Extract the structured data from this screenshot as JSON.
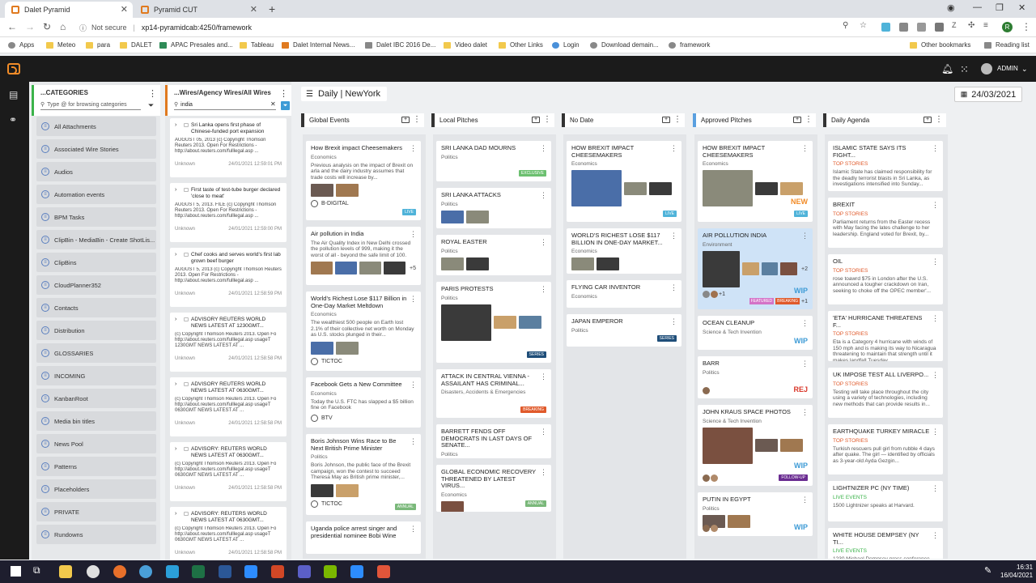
{
  "browser": {
    "tabs": [
      {
        "title": "Dalet Pyramid",
        "active": true
      },
      {
        "title": "Pyramid CUT",
        "active": false
      }
    ],
    "security": "Not secure",
    "url": "xp14-pyramidcab:4250/framework",
    "bookmarks": [
      "Apps",
      "Meteo",
      "para",
      "DALET",
      "APAC Presales and...",
      "Tableau",
      "Dalet Internal News...",
      "Dalet IBC 2016 De...",
      "Video dalet",
      "Other Links",
      "Login",
      "Download demain...",
      "framework",
      "Other bookmarks",
      "Reading list"
    ],
    "profile_initial": "R"
  },
  "header": {
    "user": "ADMIN"
  },
  "categories_panel": {
    "title": "...CATEGORIES",
    "search_placeholder": "Type @ for browsing categories",
    "items": [
      "All Attachments",
      "Associated Wire Stories",
      "Audios",
      "Automation events",
      "BPM Tasks",
      "ClipBin - MediaBin - Create ShotLis...",
      "ClipBins",
      "CloudPlanner352",
      "Contacts",
      "Distribution",
      "GLOSSARIES",
      "INCOMING",
      "KanbanRoot",
      "Media bin titles",
      "News Pool",
      "Patterns",
      "Placeholders",
      "PRIVATE",
      "Rundowns"
    ]
  },
  "wires_panel": {
    "title": "...Wires/Agency Wires/All Wires",
    "search_value": "india",
    "items": [
      {
        "title": "Sri Lanka opens first phase of Chinese-funded port expansion",
        "body": "AUGUST 05, 2013 (c) Copyright Thomson Reuters 2013. Open For Restrictions - http://about.reuters.com/fulllegal.asp ...",
        "author": "Unknown",
        "date": "24/01/2021 12:59:01 PM"
      },
      {
        "title": "First taste of test-tube burger declared 'close to meat'",
        "body": "AUGUST 5, 2013. FILE (c) Copyright Thomson Reuters 2013. Open For Restrictions - http://about.reuters.com/fulllegal.asp ...",
        "author": "Unknown",
        "date": "24/01/2021 12:59:00 PM"
      },
      {
        "title": "Chef cooks and serves world's first lab grown beef burger",
        "body": "AUGUST 5, 2013 (c) Copyright Thomson Reuters 2013. Open For Restrictions - http://about.reuters.com/fulllegal.asp ...",
        "author": "Unknown",
        "date": "24/01/2021 12:58:59 PM"
      },
      {
        "title": "ADVISORY REUTERS WORLD NEWS LATEST AT 1230GMT...",
        "body": "(c) Copyright Thomson Reuters 2013. Open Fo http://about.reuters.com/fulllegal.asp usageT 1230GMT NEWS LATEST AT ...",
        "author": "Unknown",
        "date": "24/01/2021 12:58:58 PM"
      },
      {
        "title": "ADVISORY REUTERS WORLD NEWS LATEST AT 0630GMT...",
        "body": "(c) Copyright Thomson Reuters 2013. Open Fo http://about.reuters.com/fulllegal.asp usageT 0630GMT NEWS LATEST AT ...",
        "author": "Unknown",
        "date": "24/01/2021 12:58:58 PM"
      },
      {
        "title": "ADVISORY: REUTERS WORLD NEWS LATEST AT 0630GMT...",
        "body": "(c) Copyright Thomson Reuters 2013. Open Fo http://about.reuters.com/fulllegal.asp usageT 0630GMT NEWS LATEST AT ...",
        "author": "Unknown",
        "date": "24/01/2021 12:58:58 PM"
      },
      {
        "title": "ADVISORY: REUTERS WORLD NEWS LATEST AT 0630GMT...",
        "body": "(c) Copyright Thomson Reuters 2013. Open Fo http://about.reuters.com/fulllegal.asp usageT 0630GMT NEWS LATEST AT ...",
        "author": "Unknown",
        "date": "24/01/2021 12:58:58 PM"
      }
    ]
  },
  "board": {
    "title": "Daily | NewYork",
    "date": "24/03/2021",
    "columns": [
      {
        "name": "Global Events",
        "cards": [
          {
            "title": "How Brexit impact Cheesemakers",
            "category": "Economics",
            "body": "Previous analysis on the impact of Brexit on arla and the dairy industry assumes that trade costs will increase by...",
            "author": "B-DIGITAL",
            "badge": "LIVE"
          },
          {
            "title": "Air pollution in India",
            "category": "",
            "body": "The Air Quality Index in New Delhi crossed the pollution levels of 999, making it the worst of all - beyond the safe limit of 100.",
            "more": "+5"
          },
          {
            "title": "World's Richest Lose $117 Billion in One-Day Market Meltdown",
            "category": "Economics",
            "body": "The wealthiest 500 people on Earth lost 2.1% of their collective net worth on Monday as U.S. stocks plunged in their...",
            "author": "TICTOC"
          },
          {
            "title": "Facebook Gets a New Committee",
            "category": "Economics",
            "body": "Today the U.S. FTC has slapped a $5 billion fine on Facebook",
            "author": "BTV"
          },
          {
            "title": "Boris Johnson Wins Race to Be Next British Prime Minister",
            "category": "Politics",
            "body": "Boris Johnson, the public face of the Brexit campaign, won the contest to succeed Theresa May as British prime minister,...",
            "author": "TICTOC",
            "badge": "ANNUAL"
          },
          {
            "title": "Uganda police arrest singer and presidential nominee Bobi Wine"
          }
        ]
      },
      {
        "name": "Local Pitches",
        "cards": [
          {
            "title": "SRI LANKA DAD MOURNS",
            "category": "Politics",
            "badge": "EXCLUSIVE"
          },
          {
            "title": "SRI LANKA ATTACKS",
            "category": "Politics"
          },
          {
            "title": "ROYAL EASTER",
            "category": "Politics"
          },
          {
            "title": "PARIS PROTESTS",
            "category": "Politics",
            "badge": "SERIES"
          },
          {
            "title": "ATTACK IN CENTRAL VIENNA - ASSAILANT HAS CRIMINAL...",
            "category": "Disasters, Accidents & Emergencies",
            "badge": "BREAKING"
          },
          {
            "title": "BARRETT FENDS OFF DEMOCRATS IN LAST DAYS OF SENATE...",
            "category": "Politics"
          },
          {
            "title": "GLOBAL ECONOMIC RECOVERY THREATENED BY LATEST VIRUS...",
            "category": "Economics",
            "badge": "ANNUAL"
          }
        ]
      },
      {
        "name": "No Date",
        "cards": [
          {
            "title": "HOW BREXIT IMPACT CHEESEMAKERS",
            "category": "Economics",
            "badge": "LIVE"
          },
          {
            "title": "WORLD'S RICHEST LOSE $117 BILLION IN ONE-DAY MARKET...",
            "category": "Economics"
          },
          {
            "title": "FLYING CAR INVENTOR",
            "category": "Economics"
          },
          {
            "title": "JAPAN EMPEROR",
            "category": "Politics",
            "badge": "SERIES"
          }
        ]
      },
      {
        "name": "Approved Pitches",
        "cards": [
          {
            "title": "HOW BREXIT IMPACT CHEESEMAKERS",
            "category": "Economics",
            "status": "NEW",
            "badge": "LIVE"
          },
          {
            "title": "AIR POLLUTION INDIA",
            "category": "Environment",
            "status": "WIP",
            "more": "+2",
            "people": "+1",
            "tags": [
              "FEATURED",
              "BREAKING"
            ],
            "tags_more": "+1"
          },
          {
            "title": "OCEAN CLEANUP",
            "category": "Science & Tech Invention",
            "status": "WIP"
          },
          {
            "title": "BARR",
            "category": "Politics",
            "status": "REJ"
          },
          {
            "title": "JOHN KRAUS SPACE PHOTOS",
            "category": "Science & Tech Invention",
            "status": "WIP",
            "badge": "FOLLOW-UP"
          },
          {
            "title": "PUTIN IN EGYPT",
            "category": "Politics",
            "status": "WIP"
          }
        ]
      },
      {
        "name": "Daily Agenda",
        "cards": [
          {
            "title": "ISLAMIC STATE SAYS ITS FIGHT...",
            "category": "TOP STORIES",
            "body": "Islamic State has claimed responsibility for the deadly terrorist blasts in Sri Lanka, as investigations intensified into Sunday..."
          },
          {
            "title": "BREXIT",
            "category": "TOP STORIES",
            "body": "Parliament returns from the Easter recess with May facing the lates challenge to her leadership. England voted for Brexit, by..."
          },
          {
            "title": "OIL",
            "category": "TOP STORIES",
            "body": "rose toawrd $75 in London after the U.S. announced a tougher crackdown on Iran, seeking to choke off the OPEC member'..."
          },
          {
            "title": "'ETA' HURRICANE THREATENS F...",
            "category": "TOP STORIES",
            "body": "Eta is a Category 4 hurricane with winds of 150 mph and is making its way to Nicaragua threatening to maintain that strength until it makes landfall Tuesday..."
          },
          {
            "title": "UK IMPOSE TEST ALL LIVERPO...",
            "category": "TOP STORIES",
            "body": "Testing will take place throughout the city using a variety of technologies, including new methods that can provide results in..."
          },
          {
            "title": "EARTHQUAKE TURKEY MIRACLE",
            "category": "TOP STORIES",
            "body": "Turkish rescuers pull girl from rubble 4 days after quake. The girl — identified by officials as 3-year-old Ayda Gezgin..."
          },
          {
            "title": "LIGHTNIZER PC (NY TIME)",
            "category": "LIVE EVENTS",
            "body": "1500 Lightnizer speaks at Harvard."
          },
          {
            "title": "WHITE HOUSE DEMPSEY (NY TI...",
            "category": "LIVE EVENTS",
            "body": "1230 Michael Dempsey press conference..."
          }
        ]
      }
    ]
  },
  "taskbar": {
    "time": "16:31",
    "date": "16/04/2021"
  },
  "colors": {
    "accent": "#f28c28",
    "live": "#4fb3d9",
    "wip": "#3d9bd6",
    "new": "#f28c28",
    "rej": "#d9382b",
    "red_cat": "#e05a2b",
    "green_cat": "#3bb34a"
  }
}
